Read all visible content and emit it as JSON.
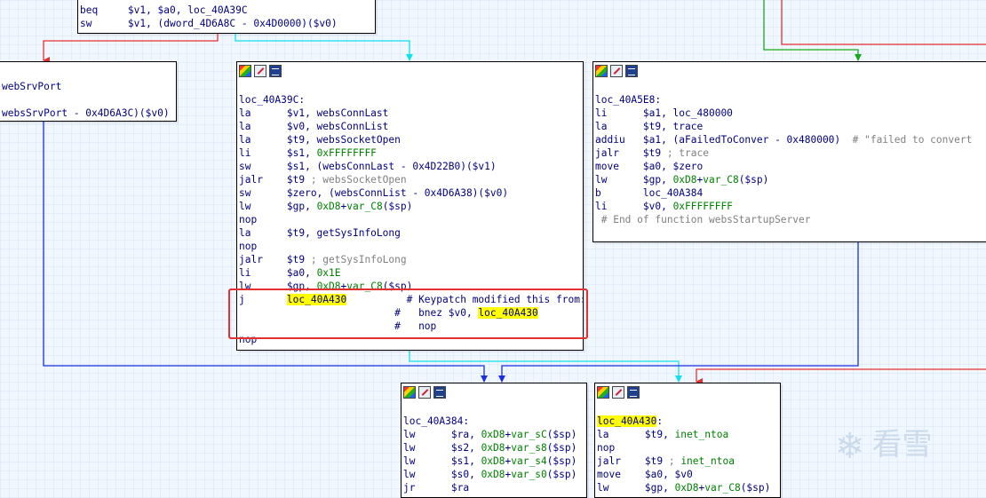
{
  "colors": {
    "edge_red": "#e53030",
    "edge_green": "#18a818",
    "edge_blue": "#1a2fe0",
    "edge_cyan": "#10e0f0",
    "highlight": "#ffff00"
  },
  "nodes": {
    "top": {
      "lines": [
        [
          {
            "t": "beq     $v1, $a0, loc_40A39C"
          }
        ],
        [
          {
            "t": "sw      $v1, (dword_4D6A8C - 0x4D0000)($v0)"
          }
        ]
      ]
    },
    "left": {
      "lines": [
        [
          {
            "t": "webSrvPort"
          }
        ],
        [
          {
            "t": ""
          }
        ],
        [
          {
            "t": "websSrvPort - 0x4D6A3C)($v0)"
          }
        ]
      ]
    },
    "mid": {
      "lines": [
        [
          {
            "t": ""
          }
        ],
        [
          {
            "t": "loc_40A39C:"
          }
        ],
        [
          {
            "t": "la      $v1, websConnLast"
          }
        ],
        [
          {
            "t": "la      $v0, websConnList"
          }
        ],
        [
          {
            "t": "la      $t9, websSocketOpen"
          }
        ],
        [
          {
            "t": "li      $s1, "
          },
          {
            "t": "0xFFFFFFFF",
            "k": "op"
          }
        ],
        [
          {
            "t": "sw      $s1, (websConnLast - 0x4D22B0)($v1)"
          }
        ],
        [
          {
            "t": "jalr    $t9 "
          },
          {
            "t": "; websSocketOpen",
            "k": "c"
          }
        ],
        [
          {
            "t": "sw      $zero, (websConnList - 0x4D6A38)($v0)"
          }
        ],
        [
          {
            "t": "lw      $gp, "
          },
          {
            "t": "0xD8",
            "k": "op"
          },
          {
            "t": "+"
          },
          {
            "t": "var_C8",
            "k": "op"
          },
          {
            "t": "($sp)"
          }
        ],
        [
          {
            "t": "nop"
          }
        ],
        [
          {
            "t": "la      $t9, getSysInfoLong"
          }
        ],
        [
          {
            "t": "nop"
          }
        ],
        [
          {
            "t": "jalr    $t9 "
          },
          {
            "t": "; getSysInfoLong",
            "k": "c"
          }
        ],
        [
          {
            "t": "li      $a0, "
          },
          {
            "t": "0x1E",
            "k": "op"
          }
        ],
        [
          {
            "t": "lw      $gp, "
          },
          {
            "t": "0xD8",
            "k": "op"
          },
          {
            "t": "+"
          },
          {
            "t": "var_C8",
            "k": "op"
          },
          {
            "t": "($sp)"
          }
        ],
        [
          {
            "t": "j       "
          },
          {
            "t": "loc_40A430",
            "k": "hl"
          },
          {
            "t": "          # Keypatch modified this from:"
          }
        ],
        [
          {
            "t": "                          #   bnez $v0, "
          },
          {
            "t": "loc_40A430",
            "k": "hl"
          }
        ],
        [
          {
            "t": "                          #   nop"
          }
        ],
        [
          {
            "t": "nop"
          }
        ]
      ]
    },
    "right": {
      "lines": [
        [
          {
            "t": ""
          }
        ],
        [
          {
            "t": "loc_40A5E8:"
          }
        ],
        [
          {
            "t": "li      $a1, loc_480000"
          }
        ],
        [
          {
            "t": "la      $t9, trace"
          }
        ],
        [
          {
            "t": "addiu   $a1, (aFailedToConver - 0x480000)  "
          },
          {
            "t": "# \"failed to convert",
            "k": "c"
          }
        ],
        [
          {
            "t": "jalr    $t9 "
          },
          {
            "t": "; trace",
            "k": "c"
          }
        ],
        [
          {
            "t": "move    $a0, $zero"
          }
        ],
        [
          {
            "t": "lw      $gp, "
          },
          {
            "t": "0xD8",
            "k": "op"
          },
          {
            "t": "+"
          },
          {
            "t": "var_C8",
            "k": "op"
          },
          {
            "t": "($sp)"
          }
        ],
        [
          {
            "t": "b       loc_40A384"
          }
        ],
        [
          {
            "t": "li      $v0, "
          },
          {
            "t": "0xFFFFFFFF",
            "k": "op"
          }
        ],
        [
          {
            "t": " # End of function websStartupServer",
            "k": "c"
          }
        ]
      ]
    },
    "bl": {
      "lines": [
        [
          {
            "t": ""
          }
        ],
        [
          {
            "t": "loc_40A384:"
          }
        ],
        [
          {
            "t": "lw      $ra, "
          },
          {
            "t": "0xD8",
            "k": "op"
          },
          {
            "t": "+"
          },
          {
            "t": "var_sC",
            "k": "op"
          },
          {
            "t": "($sp)"
          }
        ],
        [
          {
            "t": "lw      $s2, "
          },
          {
            "t": "0xD8",
            "k": "op"
          },
          {
            "t": "+"
          },
          {
            "t": "var_s8",
            "k": "op"
          },
          {
            "t": "($sp)"
          }
        ],
        [
          {
            "t": "lw      $s1, "
          },
          {
            "t": "0xD8",
            "k": "op"
          },
          {
            "t": "+"
          },
          {
            "t": "var_s4",
            "k": "op"
          },
          {
            "t": "($sp)"
          }
        ],
        [
          {
            "t": "lw      $s0, "
          },
          {
            "t": "0xD8",
            "k": "op"
          },
          {
            "t": "+"
          },
          {
            "t": "var_s0",
            "k": "op"
          },
          {
            "t": "($sp)"
          }
        ],
        [
          {
            "t": "jr      $ra"
          }
        ]
      ]
    },
    "br": {
      "lines": [
        [
          {
            "t": ""
          }
        ],
        [
          {
            "t": "loc_40A430",
            "k": "hl"
          },
          {
            "t": ":"
          }
        ],
        [
          {
            "t": "la      $t9, "
          },
          {
            "t": "inet_ntoa",
            "k": "op"
          }
        ],
        [
          {
            "t": "nop"
          }
        ],
        [
          {
            "t": "jalr    $t9 "
          },
          {
            "t": "; ",
            "k": "c"
          },
          {
            "t": "inet_ntoa",
            "k": "op"
          }
        ],
        [
          {
            "t": "move    $a0, $v0"
          }
        ],
        [
          {
            "t": "lw      $gp, "
          },
          {
            "t": "0xD8",
            "k": "op"
          },
          {
            "t": "+"
          },
          {
            "t": "var_C8",
            "k": "op"
          },
          {
            "t": "($sp)"
          }
        ]
      ]
    }
  },
  "watermark": {
    "text": "看雪",
    "icon": "snowflake-icon"
  }
}
